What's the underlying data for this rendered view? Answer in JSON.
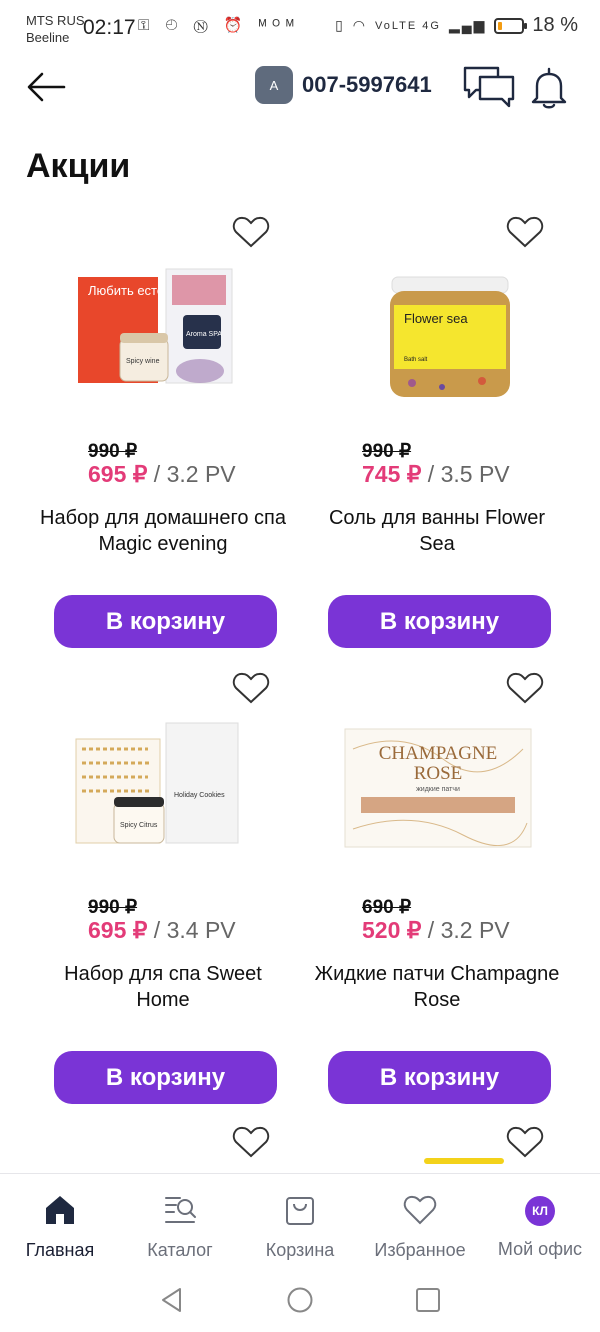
{
  "status": {
    "carrier1": "MTS RUS",
    "carrier2": "Beeline",
    "time": "02:17",
    "left_icons": "⚿ ◴ Ⓝ ⏰ ᴹᴼᴹ",
    "network": "VoLTE 4G",
    "battery_percent": 18,
    "battery_label": "18 %"
  },
  "topbar": {
    "account_initial": "A",
    "account_number": "007-5997641"
  },
  "page_title": "Акции",
  "products": [
    {
      "old_price": "990 ₽",
      "new_price": "695 ₽",
      "pv": " / 3.2 PV",
      "title": "Набор для домашнего спа Magic evening",
      "button": "В корзину"
    },
    {
      "old_price": "990 ₽",
      "new_price": "745 ₽",
      "pv": " / 3.5 PV",
      "title": "Соль для ванны Flower Sea",
      "button": "В корзину"
    },
    {
      "old_price": "990 ₽",
      "new_price": "695 ₽",
      "pv": " / 3.4 PV",
      "title": "Набор для спа Sweet Home",
      "button": "В корзину"
    },
    {
      "old_price": "690 ₽",
      "new_price": "520 ₽",
      "pv": " / 3.2 PV",
      "title": "Жидкие патчи Champagne Rose",
      "button": "В корзину"
    }
  ],
  "product_images": {
    "p1_box_text": "Любить естеств",
    "p1_jar_text": "Spicy wine",
    "p1_pack_text": "Aroma SPA",
    "p2_label": "Flower sea",
    "p2_sub": "Bath salt",
    "p3_jar_text": "Spicy Citrus",
    "p3_pack_text": "Holiday Cookies",
    "p4_line1": "CHAMPAGNE",
    "p4_line2": "ROSE",
    "p4_sub": "жидкие патчи"
  },
  "tabs": [
    {
      "label": "Главная",
      "active": true
    },
    {
      "label": "Каталог",
      "active": false
    },
    {
      "label": "Корзина",
      "active": false
    },
    {
      "label": "Избранное",
      "active": false
    },
    {
      "label": "Мой офис",
      "active": false,
      "avatar": "КЛ"
    }
  ],
  "colors": {
    "accent": "#7a34d6",
    "price_red": "#e33b78",
    "text_dark": "#1f2940"
  }
}
